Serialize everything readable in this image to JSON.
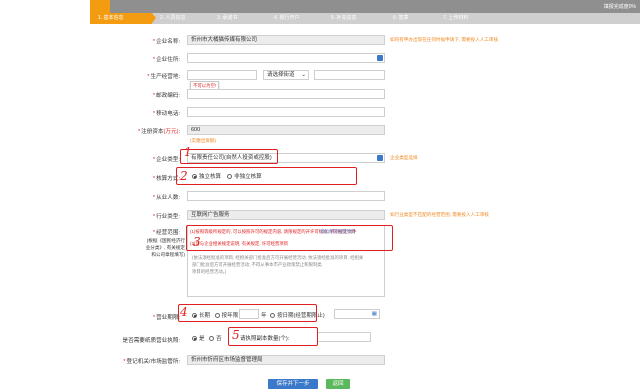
{
  "progress": {
    "label": "填报完成度0%",
    "value": 0
  },
  "steps": [
    {
      "label": "1. 基本信息"
    },
    {
      "label": "2. 人员信息"
    },
    {
      "label": "3. 承诺书"
    },
    {
      "label": "4. 银行开户"
    },
    {
      "label": "5. 补充信息"
    },
    {
      "label": "6. 签章"
    },
    {
      "label": "7. 上传材料"
    }
  ],
  "form": {
    "company_name": {
      "label": "企业名称:",
      "value": "忻州市大橘猫传媒有限公司",
      "hint": "如何有申办出现在任何时候申请下, 需要投入人工审核"
    },
    "company_address": {
      "label": "企业住所:"
    },
    "business_place": {
      "label": "生产经营地:",
      "street_placeholder": "请选择街道",
      "tooltip": "不可以为空!"
    },
    "postcode": {
      "label": "邮政编码:"
    },
    "mobile": {
      "label": "移动电话:"
    },
    "capital": {
      "label": "注册资本",
      "unit": "(万元)",
      "colon": ":",
      "value": "600",
      "note": "(实缴出资额)"
    },
    "company_type": {
      "label": "企业类型:",
      "value": "有限责任公司(自然人投资或控股)",
      "hint": "企业类型选择"
    },
    "accounting": {
      "label": "核算方式:",
      "options": [
        "独立核算",
        "非独立核算"
      ]
    },
    "employees": {
      "label": "从业人数:"
    },
    "industry": {
      "label": "行业类型:",
      "value": "互联网广告服务",
      "hint": "如行业类型不匹配的经营范围, 需要投入人工审核"
    },
    "scope": {
      "label": "经营范围:",
      "side_note_1": "(根据《国民经济行",
      "side_note_2": "业分类》, 有关规定",
      "side_note_3": "和公司章程填写)",
      "red_line_1": "(1)按照等级所规定的, 可以按照许可的规定内容, 请限规定的开许可标准, 特别规定文件",
      "red_line_2": "(2)可与企业相关规定说明, 有关规定, 许可经营项目",
      "blue_link": "添加许可经营项目",
      "gray_line_1": "(依法须经批准的项目, 经相关部门批准后方可开展经营活动, 依法须经批准的项目, 经相关",
      "gray_line_2": "部门批准后方可开展经营活动; 不得从事本市产业政策禁止和限制类",
      "gray_line_3": "项目的经营活动。)"
    },
    "period": {
      "label": "营业期限:",
      "options": [
        "长期",
        "按年限",
        "按日期(经营期限止)"
      ],
      "year_unit": "年"
    },
    "paper_license": {
      "label": "是否需要纸质营业执照:",
      "options": [
        "是",
        "否"
      ],
      "copies_label": "请执照副本数量(个):"
    },
    "authority": {
      "label": "登记机关/市场监管所:",
      "value": "忻州市忻府区市场监督管理局"
    }
  },
  "buttons": {
    "save_next": "保存并下一步",
    "back": "返回"
  },
  "annotations": [
    "1",
    "2",
    "3",
    "4",
    "5"
  ],
  "colors": {
    "accent": "#f39c12",
    "red": "#e02020",
    "blue": "#3a78c9",
    "green": "#5cb85c"
  }
}
